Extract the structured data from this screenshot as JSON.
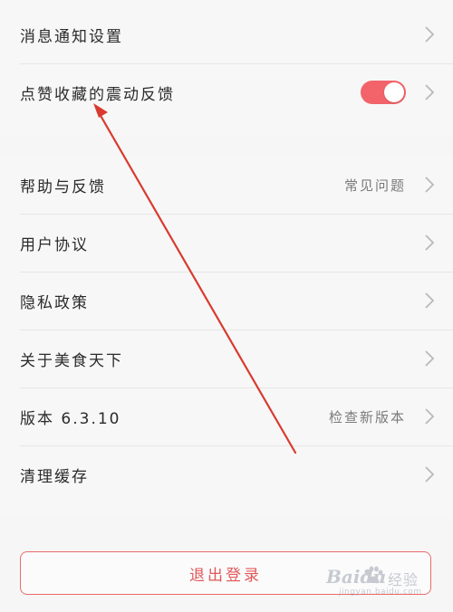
{
  "settings": {
    "notify": {
      "label": "消息通知设置"
    },
    "vibration": {
      "label": "点赞收藏的震动反馈",
      "enabled": true
    },
    "help": {
      "label": "帮助与反馈",
      "value": "常见问题"
    },
    "agreement": {
      "label": "用户协议"
    },
    "privacy": {
      "label": "隐私政策"
    },
    "about": {
      "label": "关于美食天下"
    },
    "version": {
      "label": "版本 6.3.10",
      "value": "检查新版本"
    },
    "cache": {
      "label": "清理缓存"
    }
  },
  "logout": {
    "label": "退出登录"
  },
  "watermark": {
    "brand": "Baidu",
    "suffix": "经验",
    "url": "jingyan.baidu.com"
  },
  "colors": {
    "accent": "#f2646a",
    "logout_text": "#e0585b",
    "annotation_arrow": "#d93a2f"
  },
  "icons": {
    "chevron": "chevron-right-icon",
    "paw": "baidu-paw-icon"
  }
}
